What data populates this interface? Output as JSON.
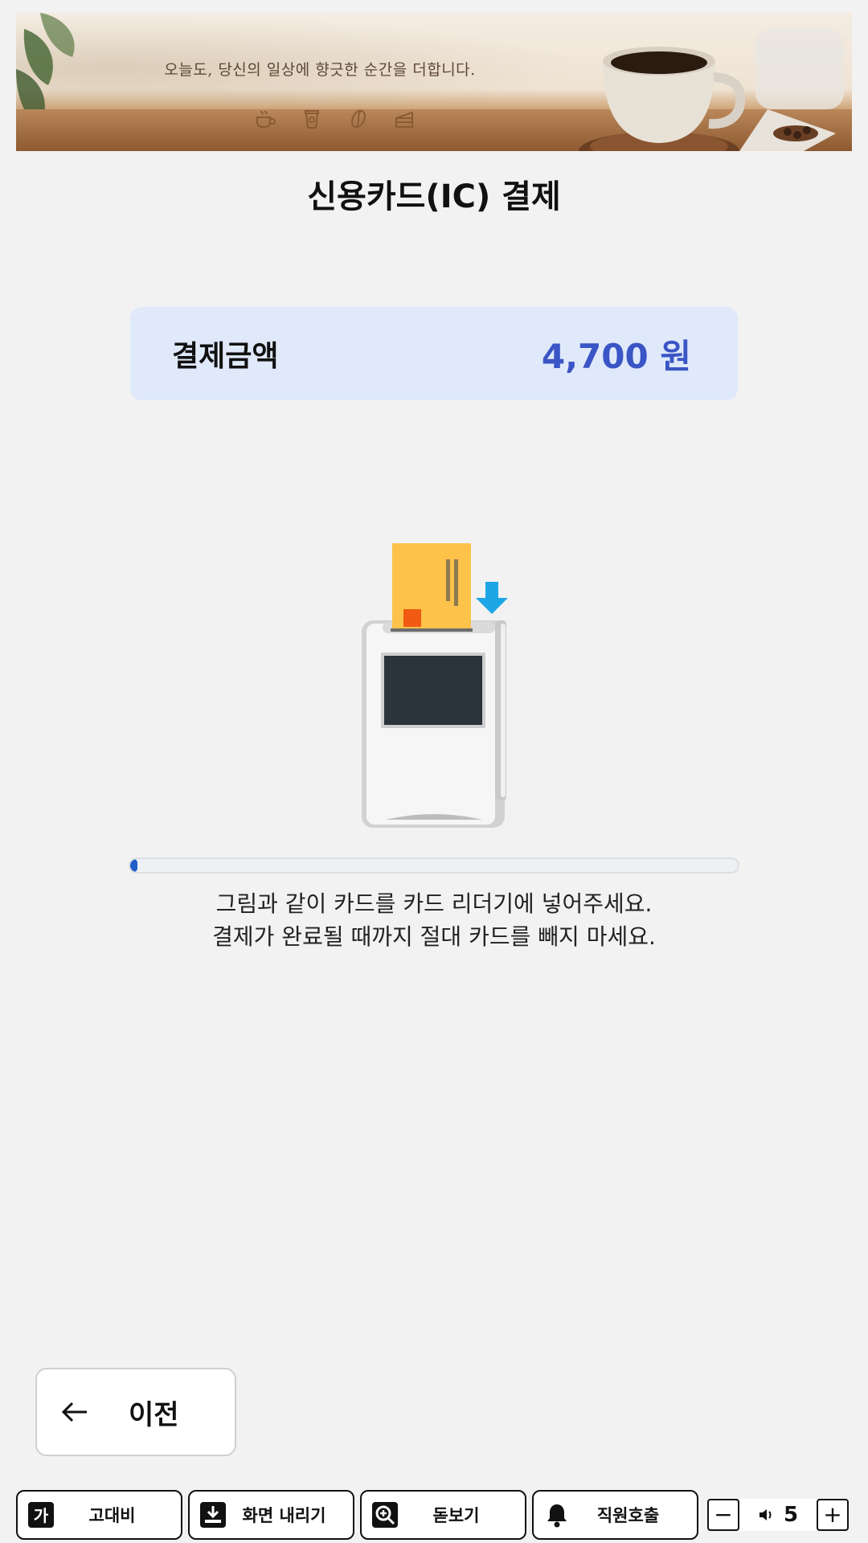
{
  "banner": {
    "tagline": "오늘도, 당신의 일상에 향긋한 순간을 더합니다.",
    "icons": [
      "coffee-cup-icon",
      "takeout-cup-icon",
      "coffee-bean-icon",
      "cake-slice-icon"
    ]
  },
  "page": {
    "title": "신용카드(IC) 결제"
  },
  "payment": {
    "label": "결제금액",
    "amount": "4,700 원",
    "amount_color": "#3a55c5"
  },
  "progress": {
    "fraction": 0.01,
    "color": "#1f5ec9"
  },
  "instructions": {
    "line1": "그림과 같이 카드를 카드 리더기에 넣어주세요.",
    "line2": "결제가 완료될 때까지 절대 카드를 빼지 마세요."
  },
  "back": {
    "label": "이전"
  },
  "toolbar": {
    "contrast_label": "고대비",
    "lower_screen_label": "화면 내리기",
    "magnifier_label": "돋보기",
    "call_staff_label": "직원호출",
    "volume_minus": "−",
    "volume_plus": "+",
    "volume_level": "5"
  }
}
